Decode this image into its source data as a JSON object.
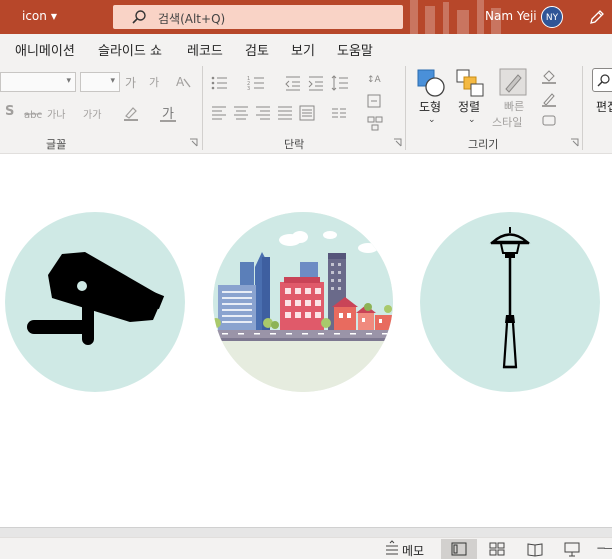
{
  "titlebar": {
    "doc_name": "icon",
    "search_placeholder": "검색(Alt+Q)",
    "user_name": "Nam Yeji",
    "user_initials": "NY"
  },
  "menu": {
    "tabs": [
      "애니메이션",
      "슬라이드 쇼",
      "레코드",
      "검토",
      "보기",
      "도움말"
    ]
  },
  "ribbon": {
    "font_group": {
      "label": "글꼴",
      "grow_font": "가",
      "shrink_font": "가",
      "shadow": "S",
      "char_spacing": "가나",
      "change_case": "가가",
      "font_color": "가"
    },
    "paragraph_group": {
      "label": "단락"
    },
    "drawing_group": {
      "label": "그리기",
      "shapes_label": "도형",
      "arrange_label": "정렬",
      "quick_styles_label": "빠른 스타일",
      "quick_styles_line1": "빠른",
      "quick_styles_line2": "스타일"
    },
    "edit_group": {
      "label_partial": "편집"
    }
  },
  "statusbar": {
    "notes_label": "메모"
  },
  "colors": {
    "accent": "#b7472a",
    "circle_fill": "#cfe9e5"
  },
  "slide": {
    "icons": [
      "surveillance-camera-icon",
      "city-skyline-icon",
      "street-lamp-icon"
    ]
  }
}
